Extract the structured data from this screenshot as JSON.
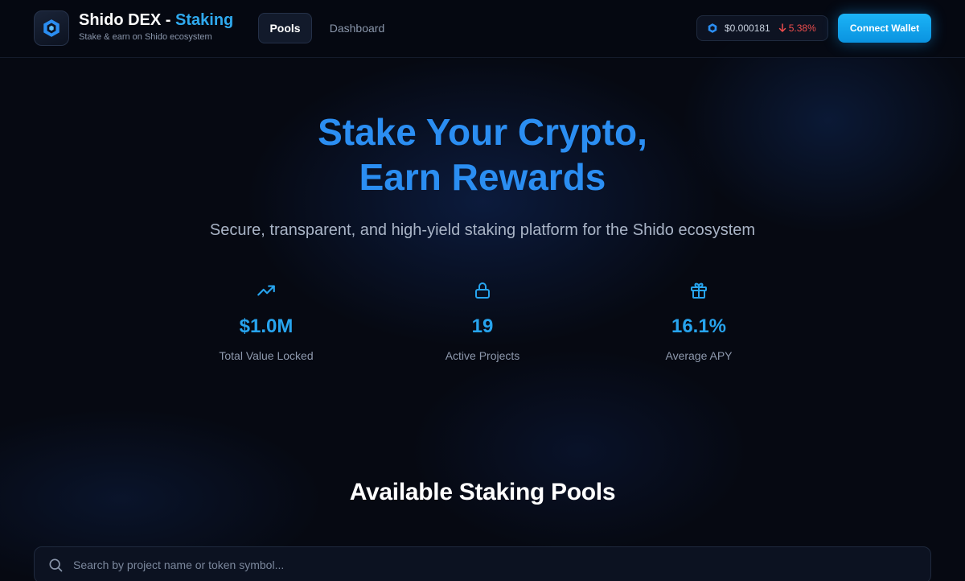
{
  "header": {
    "brand_name": "Shido DEX",
    "brand_separator": " - ",
    "brand_accent": "Staking",
    "brand_subtitle": "Stake & earn on Shido ecosystem",
    "nav": [
      {
        "label": "Pools",
        "active": true
      },
      {
        "label": "Dashboard",
        "active": false
      }
    ],
    "price": {
      "value": "$0.000181",
      "change": "5.38%",
      "direction": "down"
    },
    "connect_label": "Connect Wallet"
  },
  "hero": {
    "title_line1": "Stake Your Crypto,",
    "title_line2": "Earn Rewards",
    "subtitle": "Secure, transparent, and high-yield staking platform for the Shido ecosystem"
  },
  "stats": [
    {
      "icon": "trending-up-icon",
      "value": "$1.0M",
      "label": "Total Value Locked"
    },
    {
      "icon": "lock-icon",
      "value": "19",
      "label": "Active Projects"
    },
    {
      "icon": "gift-icon",
      "value": "16.1%",
      "label": "Average APY"
    }
  ],
  "pools": {
    "title": "Available Staking Pools",
    "search_placeholder": "Search by project name or token symbol..."
  },
  "colors": {
    "accent": "#27a4ee",
    "title_blue": "#2b8ef2",
    "background": "#060912",
    "negative": "#ef4d4d"
  }
}
